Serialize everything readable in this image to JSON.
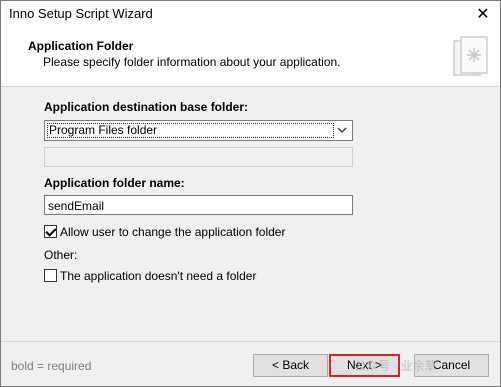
{
  "window": {
    "title": "Inno Setup Script Wizard",
    "close_glyph": "✕"
  },
  "header": {
    "title": "Application Folder",
    "subtitle": "Please specify folder information about your application."
  },
  "form": {
    "base_folder_label": "Application destination base folder:",
    "base_folder_value": "Program Files folder",
    "custom_folder_value": "",
    "folder_name_label": "Application folder name:",
    "folder_name_value": "sendEmail",
    "allow_change_label": "Allow user to change the application folder",
    "allow_change_checked": true,
    "other_label": "Other:",
    "no_folder_label": "The application doesn't need a folder",
    "no_folder_checked": false
  },
  "footer": {
    "hint": "bold = required",
    "back_label": "< Back",
    "next_label": "Next >",
    "cancel_label": "Cancel",
    "watermark": "公众号 · 业余草"
  },
  "colors": {
    "highlight_border": "#e02020"
  }
}
